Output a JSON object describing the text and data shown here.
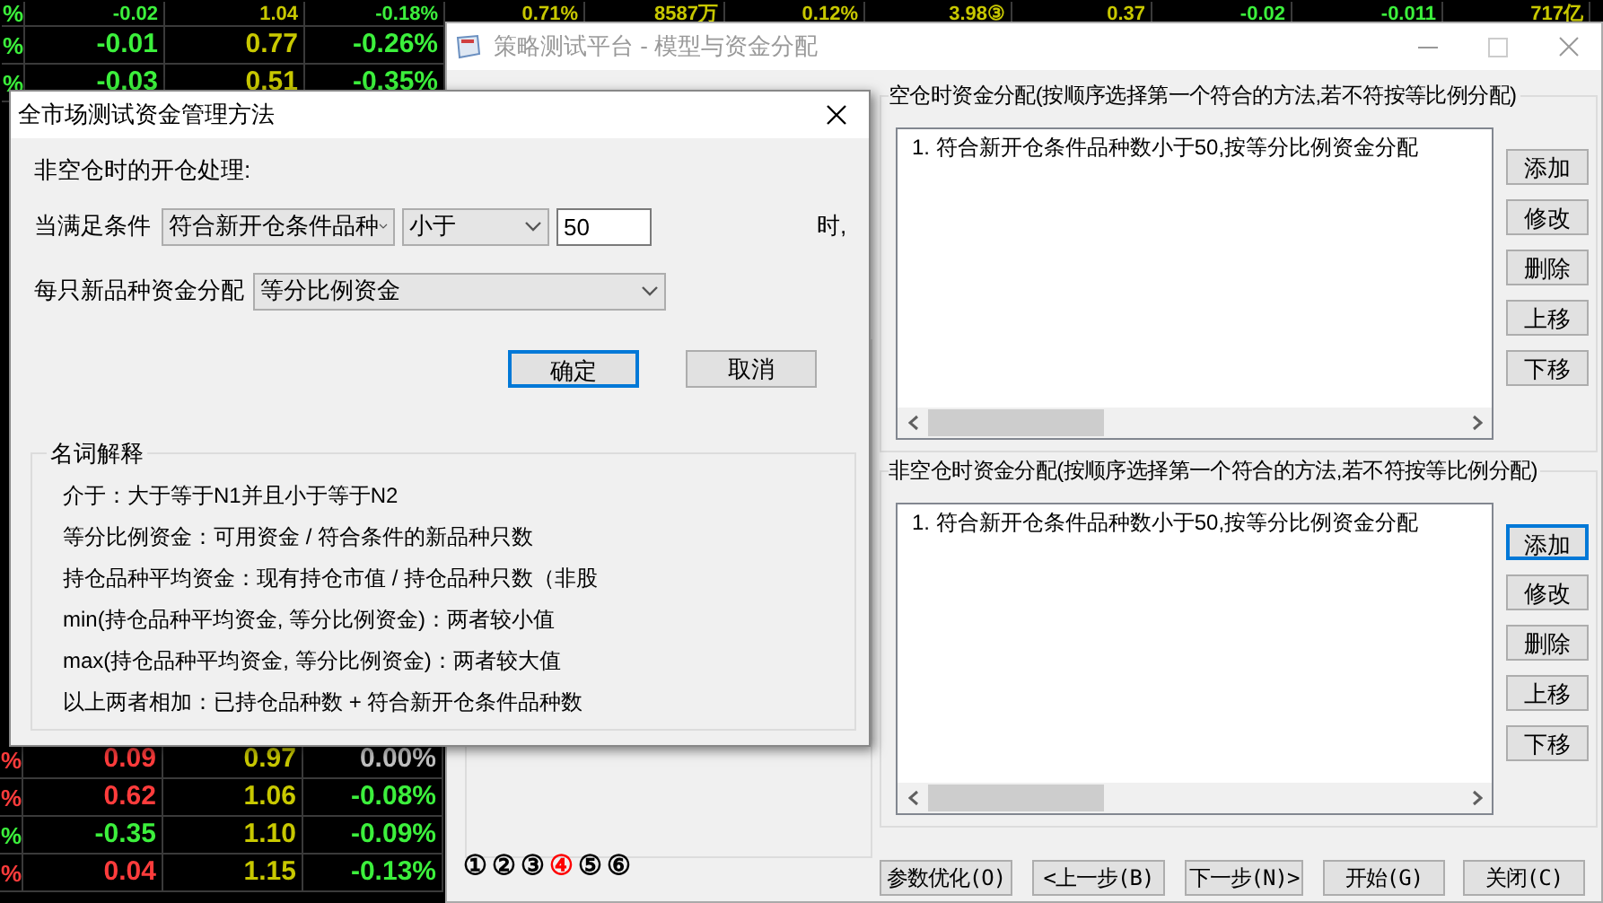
{
  "quotes": {
    "top_rows": [
      {
        "cells": [
          {
            "text": "%",
            "color": "#3cf03c"
          },
          {
            "text": "-0.02",
            "color": "#3cf03c"
          },
          {
            "text": "1.04",
            "color": "#c8c800"
          },
          {
            "text": "-0.18%",
            "color": "#3cf03c"
          },
          {
            "text": "0.71%",
            "color": "#c8c800"
          },
          {
            "text": "8587万",
            "color": "#c8c800"
          },
          {
            "text": "0.12%",
            "color": "#c8c800"
          },
          {
            "text": "3.98③",
            "color": "#c8c800"
          },
          {
            "text": "0.37",
            "color": "#c8c800"
          },
          {
            "text": "-0.02",
            "color": "#3cf03c"
          },
          {
            "text": "-0.011",
            "color": "#3cf03c"
          },
          {
            "text": "717亿",
            "color": "#c8c800"
          }
        ]
      },
      {
        "cells": [
          {
            "text": "%",
            "color": "#3cf03c"
          },
          {
            "text": "-0.01",
            "color": "#3cf03c"
          },
          {
            "text": "0.77",
            "color": "#c8c800"
          },
          {
            "text": "-0.26%",
            "color": "#3cf03c"
          }
        ]
      },
      {
        "cells": [
          {
            "text": "%",
            "color": "#3cf03c"
          },
          {
            "text": "-0.03",
            "color": "#3cf03c"
          },
          {
            "text": "0.51",
            "color": "#c8c800"
          },
          {
            "text": "-0.35%",
            "color": "#3cf03c"
          }
        ]
      }
    ],
    "bottom_rows": [
      {
        "cells": [
          {
            "text": "%",
            "color": "#ff3c3c"
          },
          {
            "text": "0.09",
            "color": "#ff3c3c"
          },
          {
            "text": "0.97",
            "color": "#c8c800"
          },
          {
            "text": "0.00%",
            "color": "#c0c0c0"
          }
        ]
      },
      {
        "cells": [
          {
            "text": "%",
            "color": "#ff3c3c"
          },
          {
            "text": "0.62",
            "color": "#ff3c3c"
          },
          {
            "text": "1.06",
            "color": "#c8c800"
          },
          {
            "text": "-0.08%",
            "color": "#3cf03c"
          }
        ]
      },
      {
        "cells": [
          {
            "text": "%",
            "color": "#3cf03c"
          },
          {
            "text": "-0.35",
            "color": "#3cf03c"
          },
          {
            "text": "1.10",
            "color": "#c8c800"
          },
          {
            "text": "-0.09%",
            "color": "#3cf03c"
          }
        ]
      },
      {
        "cells": [
          {
            "text": "%",
            "color": "#ff3c3c"
          },
          {
            "text": "0.04",
            "color": "#ff3c3c"
          },
          {
            "text": "1.15",
            "color": "#c8c800"
          },
          {
            "text": "-0.13%",
            "color": "#3cf03c"
          }
        ]
      }
    ]
  },
  "main_window": {
    "title": "策略测试平台 - 模型与资金分配",
    "groups": [
      {
        "title": "空仓时资金分配(按顺序选择第一个符合的方法,若不符按等比例分配)",
        "items": [
          "1. 符合新开仓条件品种数小于50,按等分比例资金分配"
        ],
        "buttons": [
          {
            "label": "添加",
            "focused": false
          },
          {
            "label": "修改",
            "focused": false
          },
          {
            "label": "删除",
            "focused": false
          },
          {
            "label": "上移",
            "focused": false
          },
          {
            "label": "下移",
            "focused": false
          }
        ]
      },
      {
        "title": "非空仓时资金分配(按顺序选择第一个符合的方法,若不符按等比例分配)",
        "items": [
          "1. 符合新开仓条件品种数小于50,按等分比例资金分配"
        ],
        "buttons": [
          {
            "label": "添加",
            "focused": true
          },
          {
            "label": "修改",
            "focused": false
          },
          {
            "label": "删除",
            "focused": false
          },
          {
            "label": "上移",
            "focused": false
          },
          {
            "label": "下移",
            "focused": false
          }
        ]
      }
    ],
    "steps": [
      {
        "label": "①",
        "selected": false
      },
      {
        "label": "②",
        "selected": false
      },
      {
        "label": "③",
        "selected": false
      },
      {
        "label": "④",
        "selected": true
      },
      {
        "label": "⑤",
        "selected": false
      },
      {
        "label": "⑥",
        "selected": false
      }
    ],
    "buttons": [
      "参数优化(O)",
      "<上一步(B)",
      "下一步(N)>",
      "开始(G)",
      "关闭(C)"
    ]
  },
  "dialog": {
    "title": "全市场测试资金管理方法",
    "section_label": "非空仓时的开仓处理:",
    "condition": {
      "label": "当满足条件",
      "field_select": "符合新开仓条件品种",
      "operator_select": "小于",
      "value": "50",
      "suffix": "时,"
    },
    "allocation": {
      "label": "每只新品种资金分配",
      "select": "等分比例资金"
    },
    "buttons": [
      {
        "label": "确定",
        "focused": true
      },
      {
        "label": "取消",
        "focused": false
      }
    ],
    "glossary": {
      "title": "名词解释",
      "lines": [
        "介于：大于等于N1并且小于等于N2",
        "等分比例资金：可用资金 / 符合条件的新品种只数",
        "持仓品种平均资金：现有持仓市值 / 持仓品种只数（非股",
        "min(持仓品种平均资金, 等分比例资金)：两者较小值",
        "max(持仓品种平均资金, 等分比例资金)：两者较大值",
        "以上两者相加：已持仓品种数 + 符合新开仓条件品种数"
      ]
    }
  }
}
